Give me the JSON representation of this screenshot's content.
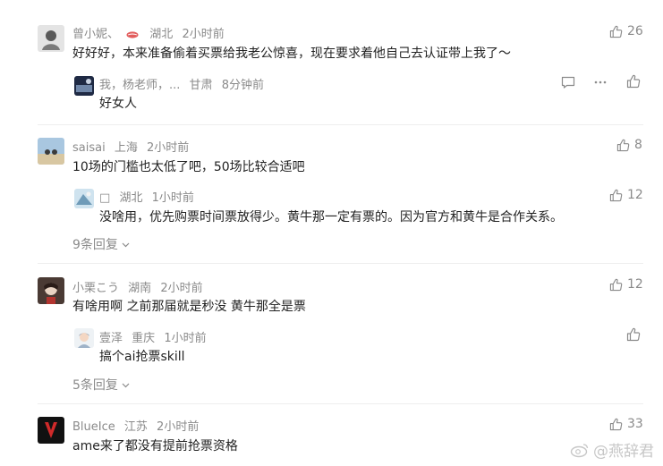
{
  "comments": [
    {
      "name": "曾小妮、",
      "location": "湖北",
      "time": "2小时前",
      "text": "好好好，本来准备偷着买票给我老公惊喜，现在要求着他自己去认证带上我了～",
      "likes": "26",
      "reply": {
        "name": "我，杨老师，...",
        "location": "甘肃",
        "time": "8分钟前",
        "text": "好女人"
      }
    },
    {
      "name": "saisai",
      "location": "上海",
      "time": "2小时前",
      "text": "10场的门槛也太低了吧，50场比较合适吧",
      "likes": "8",
      "reply": {
        "name": "□",
        "location": "湖北",
        "time": "1小时前",
        "text": "没啥用，优先购票时间票放得少。黄牛那一定有票的。因为官方和黄牛是合作关系。",
        "likes": "12"
      },
      "more": "9条回复"
    },
    {
      "name": "小栗こう",
      "location": "湖南",
      "time": "2小时前",
      "text": "有啥用啊 之前那届就是秒没 黄牛那全是票",
      "likes": "12",
      "reply": {
        "name": "壹泽",
        "location": "重庆",
        "time": "1小时前",
        "text": "搞个ai抢票skill"
      },
      "more": "5条回复"
    },
    {
      "name": "BlueIce",
      "location": "江苏",
      "time": "2小时前",
      "text": "ame来了都没有提前抢票资格",
      "likes": "33"
    }
  ],
  "watermark": "@燕辞君",
  "colors": {
    "meta": "#8a8a8a",
    "text": "#222222",
    "divider": "#eeeeee"
  },
  "icons": [
    "thumb-up-icon",
    "comment-icon",
    "more-dots-icon",
    "chevron-down-icon",
    "weibo-logo-icon"
  ]
}
